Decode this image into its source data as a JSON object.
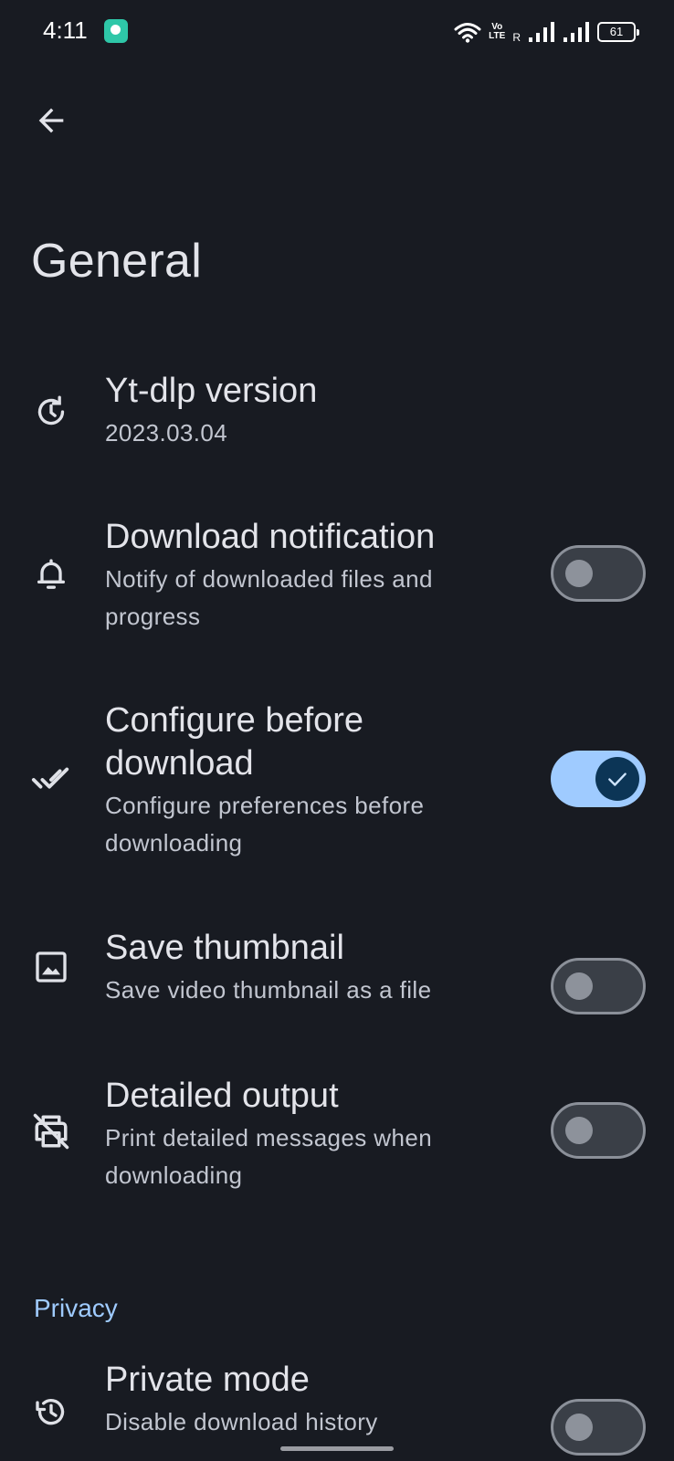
{
  "status_bar": {
    "time": "4:11",
    "volte_top": "Vo",
    "volte_bottom": "LTE",
    "roaming": "R",
    "battery": "61"
  },
  "header": {
    "back_icon": "arrow-back-icon",
    "title": "General"
  },
  "settings": [
    {
      "icon": "update-history-icon",
      "title": "Yt-dlp version",
      "subtitle": "2023.03.04"
    },
    {
      "icon": "bell-icon",
      "title": "Download notification",
      "subtitle": "Notify of downloaded files and progress",
      "toggle": false
    },
    {
      "icon": "done-all-icon",
      "title": "Configure before download",
      "subtitle": "Configure preferences before downloading",
      "toggle": true
    },
    {
      "icon": "image-icon",
      "title": "Save thumbnail",
      "subtitle": "Save video thumbnail as a file",
      "toggle": false
    },
    {
      "icon": "print-disabled-icon",
      "title": "Detailed output",
      "subtitle": "Print detailed messages when downloading",
      "toggle": false
    }
  ],
  "privacy": {
    "header": "Privacy",
    "items": [
      {
        "icon": "history-icon",
        "title": "Private mode",
        "subtitle": "Disable download history",
        "toggle": false
      }
    ]
  },
  "colors": {
    "background": "#181b22",
    "accent": "#9fcbff",
    "switch_on_thumb": "#0c3556",
    "switch_off_track": "#3a3f47"
  }
}
